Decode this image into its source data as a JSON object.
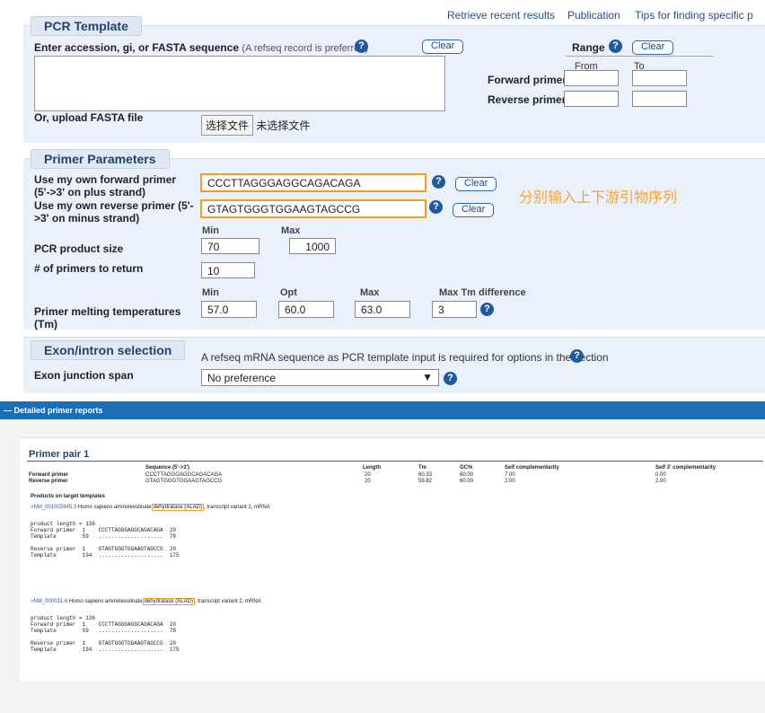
{
  "top_links": [
    "Retrieve recent results",
    "Publication",
    "Tips for finding specific p"
  ],
  "pcr_template": {
    "title": "PCR Template",
    "enter_label": "Enter accession, gi, or FASTA sequence",
    "enter_note": "(A refseq record is preferred)",
    "clear": "Clear",
    "range_label": "Range",
    "range_clear": "Clear",
    "from": "From",
    "to": "To",
    "forward_primer": "Forward primer",
    "reverse_primer": "Reverse primer",
    "upload_label": "Or, upload FASTA file",
    "choose_file": "选择文件",
    "no_file": "未选择文件"
  },
  "primer_params": {
    "title": "Primer Parameters",
    "fwd_label_1": "Use my own forward primer",
    "fwd_label_2": "(5'->3' on plus strand)",
    "fwd_value": "CCCTTAGGGAGGCAGACAGA",
    "rev_label_1": "Use my own reverse primer (5'-",
    "rev_label_2": ">3' on minus strand)",
    "rev_value": "GTAGTGGGTGGAAGTAGCCG",
    "clear": "Clear",
    "annotation": "分别输入上下游引物序列",
    "min": "Min",
    "max": "Max",
    "opt": "Opt",
    "max_tm_diff": "Max Tm difference",
    "product_size_label": "PCR product size",
    "product_min": "70",
    "product_max": "1000",
    "num_primers_label": "# of primers to return",
    "num_primers": "10",
    "tm_label_1": "Primer melting temperatures",
    "tm_label_2": "(Tm)",
    "tm_min": "57.0",
    "tm_opt": "60.0",
    "tm_max": "63.0",
    "tm_diff": "3"
  },
  "exon": {
    "title": "Exon/intron selection",
    "note": "A refseq mRNA sequence as PCR template input is required for options in the section",
    "junction_label": "Exon junction span",
    "junction_value": "No preference"
  },
  "report": {
    "bar_title": "— Detailed primer reports",
    "pair_title": "Primer pair 1",
    "headers": [
      "Sequence (5'->3')",
      "Length",
      "Tm",
      "GC%",
      "Self complementarity",
      "Self 3' complementarity"
    ],
    "rows": [
      {
        "name": "Forward primer",
        "seq": "CCCTTAGGGAGGCAGACAGA",
        "length": "20",
        "tm": "60.33",
        "gc": "60.00",
        "self": "7.00",
        "self3": "0.00"
      },
      {
        "name": "Reverse primer",
        "seq": "GTAGTGGGTGGAAGTAGCCG",
        "length": "20",
        "tm": "59.82",
        "gc": "60.00",
        "self": "2.00",
        "self3": "2.00"
      }
    ],
    "products_title": "Products on target templates",
    "products": [
      {
        "accession": ">NM_001003945.3",
        "desc_a": "Homo sapiens aminolevulinate",
        "desc_hl": "dehydratase (ALAD)",
        "desc_b": ", transcript variant 1, mRNA",
        "lines": "product length = 136\nForward primer  1    CCCTTAGGGAGGCAGACAGA  20\nTemplate        59   ....................  78\n\nReverse primer  1    GTAGTGGGTGGAAGTAGCCG  20\nTemplate        194  ....................  175"
      },
      {
        "accession": ">NM_000031.6",
        "desc_a": "Homo sapiens aminolevulinate",
        "desc_hl": "dehydratase (ALAD)",
        "desc_b": ", transcript variant 2, mRNA",
        "lines": "product length = 136\nForward primer  1    CCCTTAGGGAGGCAGACAGA  20\nTemplate        59   ....................  78\n\nReverse primer  1    GTAGTGGGTGGAAGTAGCCG  20\nTemplate        194  ....................  175"
      }
    ]
  },
  "colors": {
    "accent": "#1f5a9f",
    "highlight": "#f0a020",
    "report_bar": "#1b6eb3"
  },
  "icons": {
    "help": "question-circle-icon",
    "collapse": "minus-icon"
  }
}
